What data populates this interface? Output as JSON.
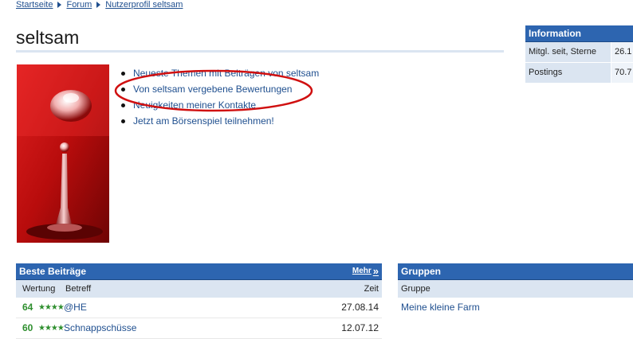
{
  "breadcrumb": [
    "Startseite",
    "Forum",
    "Nutzerprofil seltsam"
  ],
  "page_title": "seltsam",
  "profile_links": [
    "Neueste Themen mit Beiträgen von seltsam",
    "Von seltsam vergebene Bewertungen",
    "Neuigkeiten meiner Kontakte",
    "Jetzt am Börsenspiel teilnehmen!"
  ],
  "information": {
    "title": "Information",
    "rows": [
      {
        "label": "Mitgl. seit, Sterne",
        "value": "26.1"
      },
      {
        "label": "Postings",
        "value": "70.7"
      }
    ]
  },
  "beste": {
    "title": "Beste Beiträge",
    "more_label": "Mehr",
    "more_arrow": "»",
    "columns": {
      "wertung": "Wertung",
      "betreff": "Betreff",
      "zeit": "Zeit"
    },
    "rows": [
      {
        "score": "64",
        "stars": "★★★★",
        "subject": "@HE",
        "date": "27.08.14"
      },
      {
        "score": "60",
        "stars": "★★★★",
        "subject": "Schnappschüsse",
        "date": "12.07.12"
      }
    ]
  },
  "gruppen": {
    "title": "Gruppen",
    "column": "Gruppe",
    "rows": [
      "Meine kleine Farm"
    ]
  },
  "colors": {
    "header_blue": "#2d65b0",
    "light_blue": "#dbe5f1",
    "link": "#1f4f8f",
    "annotation_red": "#d01010"
  }
}
